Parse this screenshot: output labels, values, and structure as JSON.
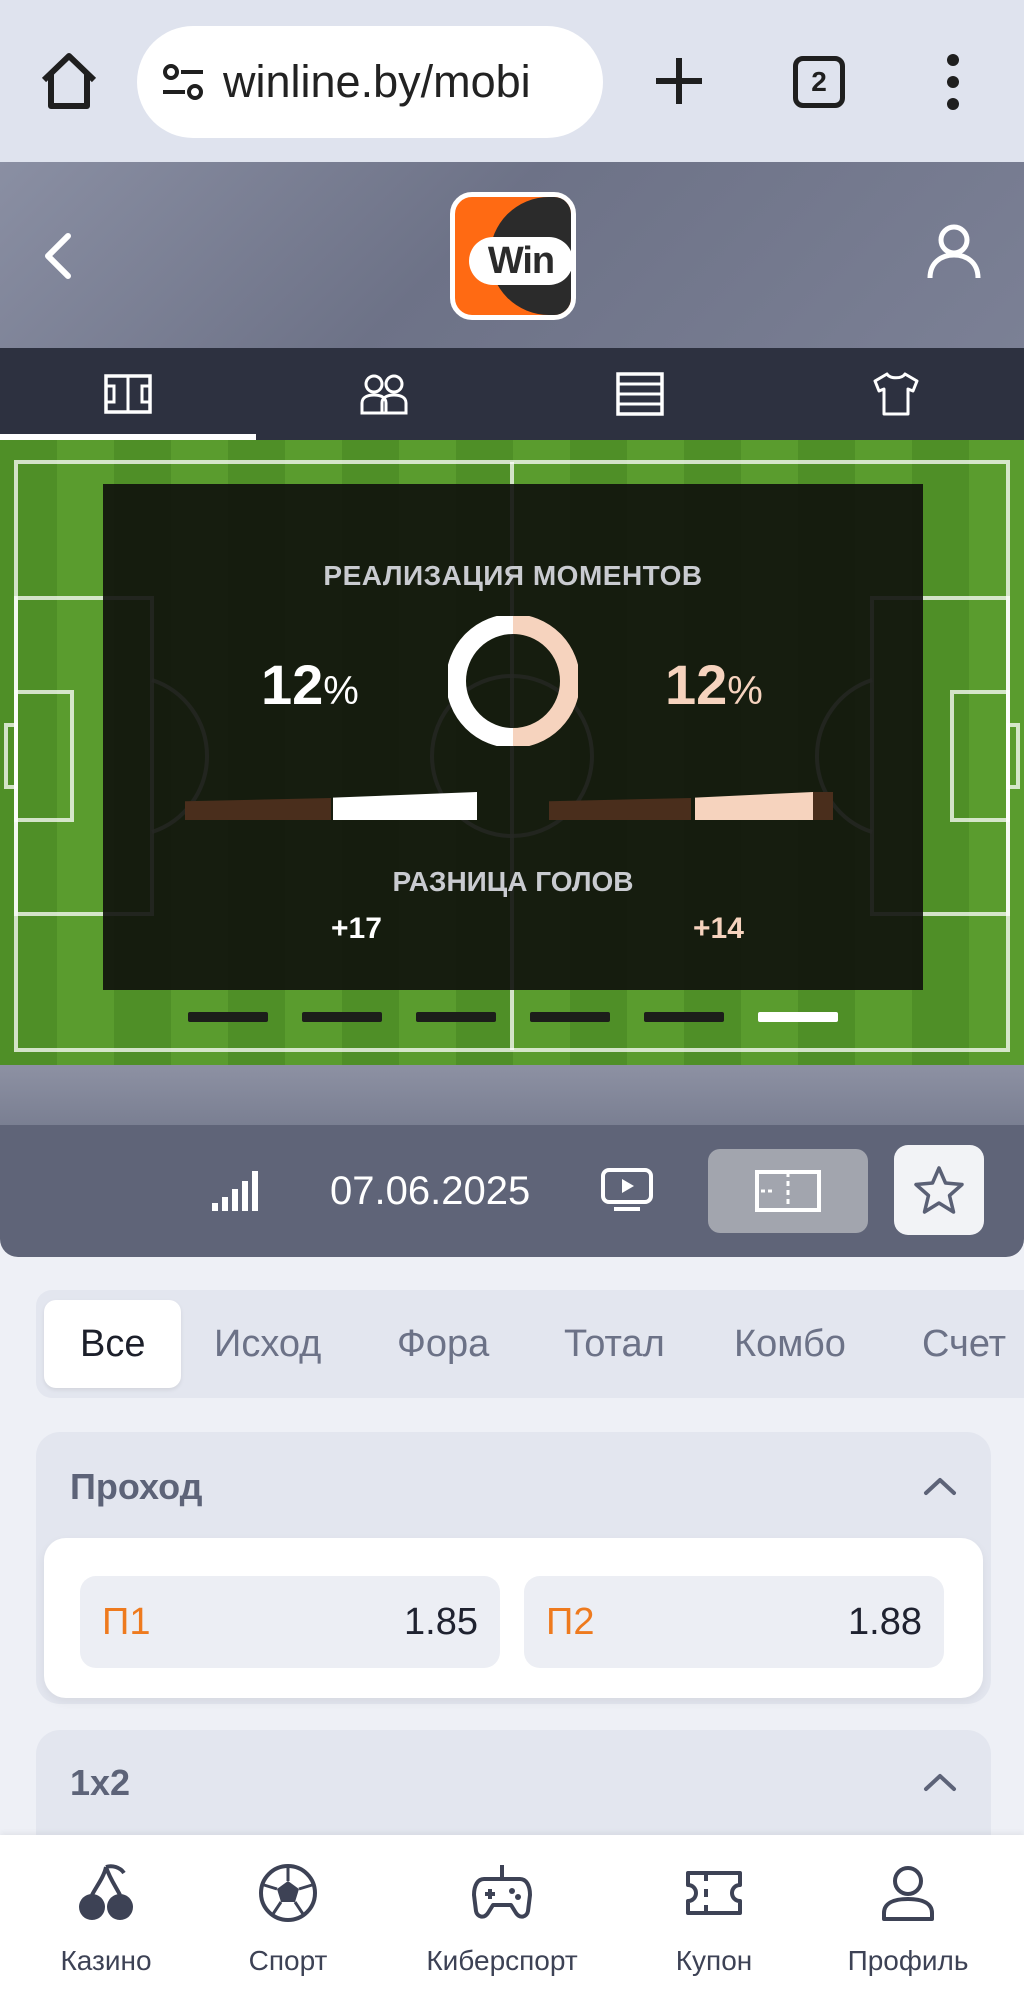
{
  "browser": {
    "url": "winline.by/mobi",
    "tab_count": "2"
  },
  "header": {
    "logo_text": "Win"
  },
  "stats": {
    "title": "РЕАЛИЗАЦИЯ МОМЕНТОВ",
    "home_pct": "12",
    "away_pct": "12",
    "pct_sign": "%",
    "goal_diff_title": "РАЗНИЦА ГОЛОВ",
    "home_goal_diff": "+17",
    "away_goal_diff": "+14",
    "home_color": "#ffffff",
    "away_color": "#f6d3be",
    "slides_count": 6,
    "active_slide": 6
  },
  "match": {
    "date": "07.06.2025"
  },
  "bet_tabs": [
    "Все",
    "Исход",
    "Фора",
    "Тотал",
    "Комбо",
    "Счет"
  ],
  "markets": [
    {
      "name": "Проход",
      "odds": [
        {
          "label": "П1",
          "value": "1.85"
        },
        {
          "label": "П2",
          "value": "1.88"
        }
      ]
    },
    {
      "name": "1x2"
    }
  ],
  "bottom_nav": [
    {
      "label": "Казино",
      "icon": "cherries-icon"
    },
    {
      "label": "Спорт",
      "icon": "soccer-ball-icon"
    },
    {
      "label": "Киберспорт",
      "icon": "gamepad-icon"
    },
    {
      "label": "Купон",
      "icon": "ticket-icon"
    },
    {
      "label": "Профиль",
      "icon": "user-icon"
    }
  ],
  "colors": {
    "accent_orange": "#ff6a13",
    "odds_label": "#ee7a1e"
  }
}
